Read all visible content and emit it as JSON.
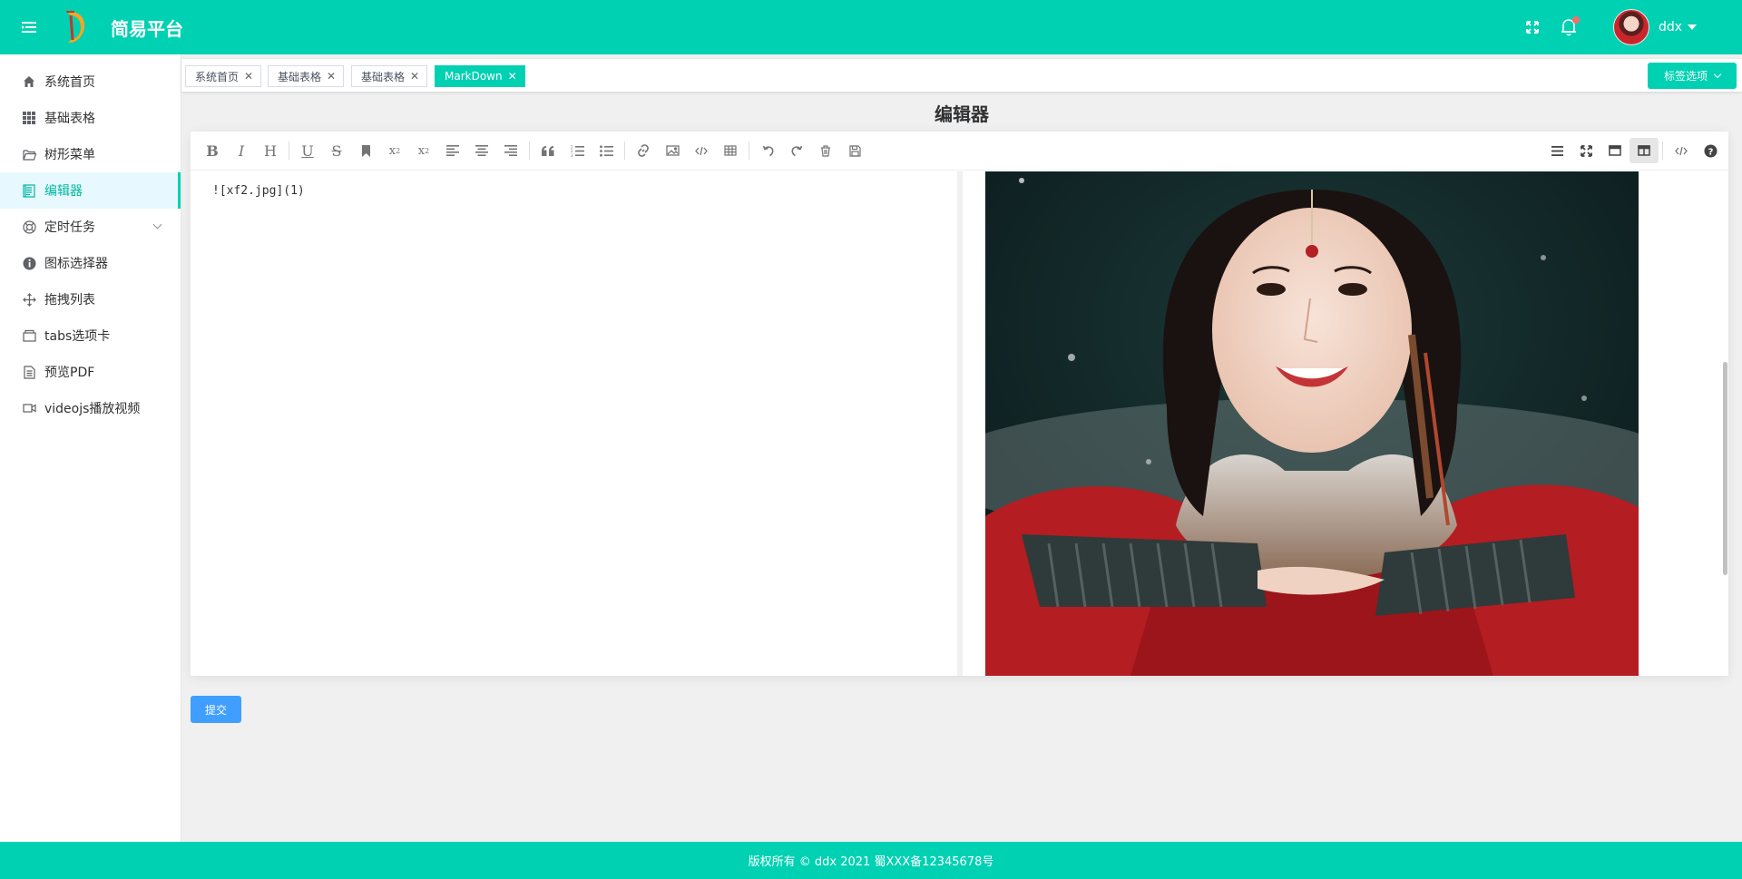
{
  "header": {
    "brand": "简易平台",
    "username": "ddx",
    "icons": [
      "menu-toggle-icon",
      "logo-icon",
      "fullscreen-icon",
      "bell-icon"
    ],
    "accent_color": "#00d1b2",
    "notification_dot_color": "#f56c6c"
  },
  "sidebar": {
    "items": [
      {
        "label": "系统首页",
        "icon": "home-icon"
      },
      {
        "label": "基础表格",
        "icon": "grid-icon"
      },
      {
        "label": "树形菜单",
        "icon": "folder-icon"
      },
      {
        "label": "编辑器",
        "icon": "document-icon",
        "active": true
      },
      {
        "label": "定时任务",
        "icon": "lifebuoy-icon",
        "has_submenu": true
      },
      {
        "label": "图标选择器",
        "icon": "info-icon"
      },
      {
        "label": "拖拽列表",
        "icon": "move-icon"
      },
      {
        "label": "tabs选项卡",
        "icon": "tabs-icon"
      },
      {
        "label": "预览PDF",
        "icon": "file-icon"
      },
      {
        "label": "videojs播放视频",
        "icon": "video-icon"
      }
    ]
  },
  "tabs": {
    "items": [
      {
        "label": "系统首页"
      },
      {
        "label": "基础表格"
      },
      {
        "label": "基础表格"
      },
      {
        "label": "MarkDown",
        "active": true
      }
    ],
    "options_label": "标签选项"
  },
  "main": {
    "title": "编辑器",
    "editor": {
      "content": "![xf2.jpg](1)",
      "toolbar_left": [
        "bold-icon",
        "italic-icon",
        "header-icon",
        "underline-icon",
        "strikethrough-icon",
        "mark-icon",
        "superscript-icon",
        "subscript-icon",
        "align-left-icon",
        "align-center-icon",
        "align-right-icon",
        "quote-icon",
        "ordered-list-icon",
        "unordered-list-icon",
        "link-icon",
        "image-icon",
        "code-icon",
        "table-icon",
        "undo-icon",
        "redo-icon",
        "trash-icon",
        "save-icon"
      ],
      "toolbar_right": [
        "navigation-icon",
        "fullscreen-icon",
        "read-mode-icon",
        "subfield-icon",
        "html-icon",
        "help-icon"
      ]
    },
    "submit_label": "提交"
  },
  "footer": {
    "text": "版权所有 © ddx 2021 蜀XXX备12345678号"
  }
}
